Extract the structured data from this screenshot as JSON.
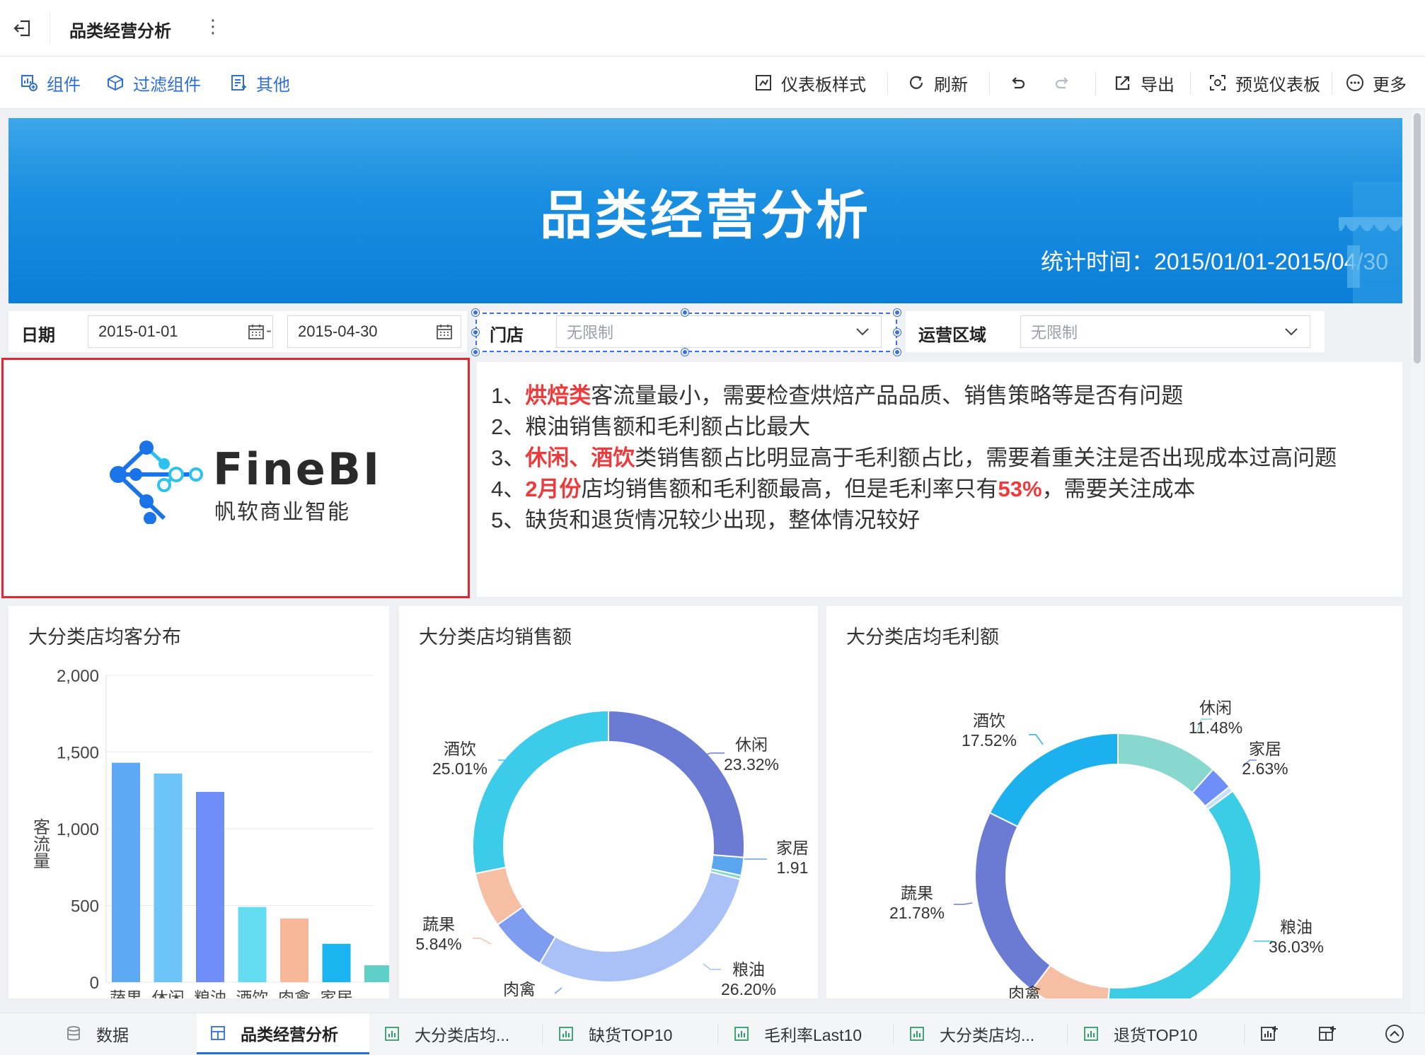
{
  "header": {
    "title": "品类经营分析"
  },
  "toolbar": {
    "left": [
      "组件",
      "过滤组件",
      "其他"
    ],
    "right": [
      "仪表板样式",
      "刷新",
      "导出",
      "预览仪表板",
      "更多"
    ]
  },
  "banner": {
    "title": "品类经营分析",
    "date_range": "统计时间：2015/01/01-2015/04/30"
  },
  "filters": {
    "date_label": "日期",
    "date_start": "2015-01-01",
    "date_dash": "-",
    "date_end": "2015-04-30",
    "store_label": "门店",
    "store_value": "无限制",
    "region_label": "运营区域",
    "region_value": "无限制"
  },
  "logo": {
    "word": "FineBI",
    "sub": "帆软商业智能"
  },
  "insights": {
    "l1_pre": "1、",
    "l1_hl": "烘焙类",
    "l1_post": "客流量最小，需要检查烘焙产品品质、销售策略等是否有问题",
    "l2": "2、粮油销售额和毛利额占比最大",
    "l3_pre": "3、",
    "l3_hl": "休闲、酒饮",
    "l3_post": "类销售额占比明显高于毛利额占比，需要着重关注是否出现成本过高问题",
    "l4_pre": "4、",
    "l4_hl": "2月份",
    "l4_mid": "店均销售额和毛利额最高，但是毛利率只有",
    "l4_hl2": "53%",
    "l4_post": "，需要关注成本",
    "l5": "5、缺货和退货情况较少出现，整体情况较好"
  },
  "chart_data": [
    {
      "type": "bar",
      "title": "大分类店均客分布",
      "ylabel": "客流量",
      "ylim": [
        0,
        2000
      ],
      "yticks": [
        "2,000",
        "1,500",
        "1,000",
        "500",
        "0"
      ],
      "categories": [
        "蔬果",
        "休闲",
        "粮油",
        "酒饮",
        "肉禽",
        "家居",
        ""
      ],
      "values": [
        1430,
        1360,
        1240,
        490,
        415,
        250,
        110
      ],
      "colors": [
        "#5ea9f5",
        "#6cc4f7",
        "#6f8ef7",
        "#63dcf2",
        "#f7b89a",
        "#1ab5f0",
        "#5ed0c8"
      ]
    },
    {
      "type": "pie",
      "title": "大分类店均销售额",
      "slices": [
        {
          "name": "休闲",
          "value": 23.32,
          "label": "23.32%",
          "color": "#6b7bd4"
        },
        {
          "name": "家居",
          "value": 1.91,
          "label": "1.91",
          "color": "#5aa6f0"
        },
        {
          "name": "",
          "value": 0.4,
          "label": "",
          "color": "#7fd8c8"
        },
        {
          "name": "粮油",
          "value": 26.2,
          "label": "26.20%",
          "color": "#a9c1f7"
        },
        {
          "name": "肉禽",
          "value": 6.0,
          "label": "",
          "color": "#7e9cf0"
        },
        {
          "name": "蔬果",
          "value": 5.84,
          "label": "5.84%",
          "color": "#f6bfa3"
        },
        {
          "name": "酒饮",
          "value": 25.01,
          "label": "25.01%",
          "color": "#3ccbe8"
        }
      ]
    },
    {
      "type": "pie",
      "title": "大分类店均毛利额",
      "slices": [
        {
          "name": "休闲",
          "value": 11.48,
          "label": "11.48%",
          "color": "#88d8cf"
        },
        {
          "name": "家居",
          "value": 2.63,
          "label": "2.63%",
          "color": "#6f8ef7"
        },
        {
          "name": "",
          "value": 0.6,
          "label": "",
          "color": "#c8e0ff"
        },
        {
          "name": "粮油",
          "value": 36.03,
          "label": "36.03%",
          "color": "#3ccde6"
        },
        {
          "name": "肉禽",
          "value": 9.0,
          "label": "",
          "color": "#f6bfa3"
        },
        {
          "name": "蔬果",
          "value": 21.78,
          "label": "21.78%",
          "color": "#6b7bd4"
        },
        {
          "name": "酒饮",
          "value": 17.52,
          "label": "17.52%",
          "color": "#1cb0ef"
        }
      ]
    }
  ],
  "tabs": [
    "数据",
    "品类经营分析",
    "大分类店均...",
    "缺货TOP10",
    "毛利率Last10",
    "大分类店均...",
    "退货TOP10"
  ],
  "colors": {
    "accent": "#2c6fd6",
    "banner": "#1b8fe0",
    "highlight": "#ee3a3a"
  }
}
